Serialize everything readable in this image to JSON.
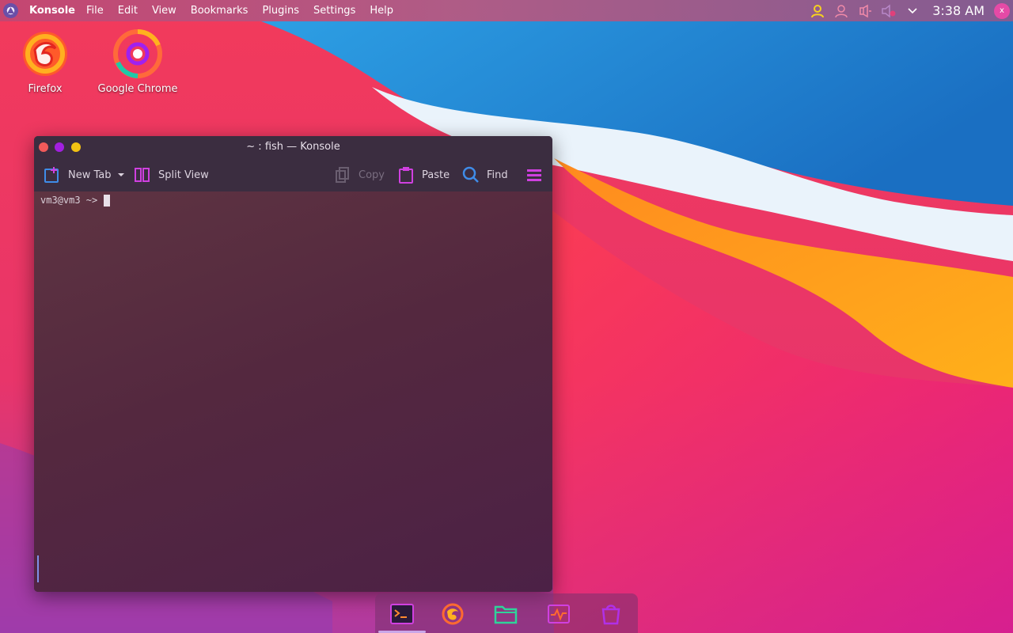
{
  "panel": {
    "launcher_icon": "plasma-launcher-icon",
    "app_name": "Konsole",
    "menu": [
      "File",
      "Edit",
      "View",
      "Bookmarks",
      "Plugins",
      "Settings",
      "Help"
    ],
    "tray_icons": [
      "user-icon",
      "user-outline-icon",
      "network-icon",
      "volume-muted-icon",
      "chevron-down-icon"
    ],
    "clock": "3:38 AM",
    "avatar_initial": "x"
  },
  "desktop_icons": [
    {
      "label": "Firefox",
      "icon": "firefox-icon"
    },
    {
      "label": "Google Chrome",
      "icon": "chrome-icon"
    }
  ],
  "window": {
    "title": "~ : fish — Konsole",
    "toolbar": {
      "new_tab": "New Tab",
      "split_view": "Split View",
      "copy": "Copy",
      "paste": "Paste",
      "find": "Find"
    },
    "terminal": {
      "prompt": "vm3@vm3 ~>"
    }
  },
  "dock": {
    "items": [
      "terminal-icon",
      "firefox-icon",
      "files-icon",
      "system-monitor-icon",
      "store-icon"
    ]
  },
  "colors": {
    "accent": "#c02ed8",
    "close": "#f25a5a",
    "minimize": "#a21fe0",
    "maximize": "#f3c213"
  }
}
